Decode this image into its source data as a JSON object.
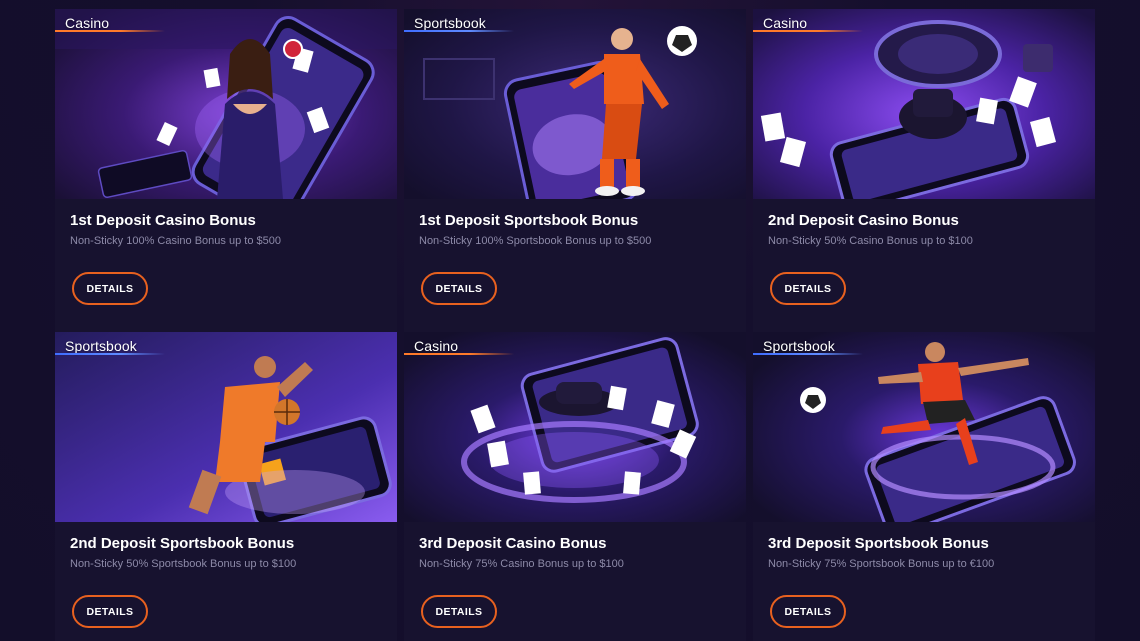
{
  "colors": {
    "background": "#140f2c",
    "card": "#17122f",
    "accent_orange": "#e8611f",
    "accent_blue": "#3f6dff",
    "desc_text": "#8d8aa8"
  },
  "button_label": "DETAILS",
  "promotions": [
    {
      "category": "Casino",
      "title": "1st Deposit Casino Bonus",
      "description": "Non-Sticky 100% Casino Bonus up to $500",
      "button": "DETAILS",
      "art": "casino-woman-cards"
    },
    {
      "category": "Sportsbook",
      "title": "1st Deposit Sportsbook Bonus",
      "description": "Non-Sticky 100% Sportsbook Bonus up to $500",
      "button": "DETAILS",
      "art": "soccer-player-ball"
    },
    {
      "category": "Casino",
      "title": "2nd Deposit Casino Bonus",
      "description": "Non-Sticky 50% Casino Bonus up to $100",
      "button": "DETAILS",
      "art": "roulette-hat-cards"
    },
    {
      "category": "Sportsbook",
      "title": "2nd Deposit Sportsbook Bonus",
      "description": "Non-Sticky 50% Sportsbook Bonus up to $100",
      "button": "DETAILS",
      "art": "basketball-player"
    },
    {
      "category": "Casino",
      "title": "3rd Deposit Casino Bonus",
      "description": "Non-Sticky 75% Casino Bonus up to $100",
      "button": "DETAILS",
      "art": "hat-cards-portal"
    },
    {
      "category": "Sportsbook",
      "title": "3rd Deposit Sportsbook Bonus",
      "description": "Non-Sticky 75% Sportsbook Bonus up to €100",
      "button": "DETAILS",
      "art": "soccer-kick-phone"
    }
  ]
}
